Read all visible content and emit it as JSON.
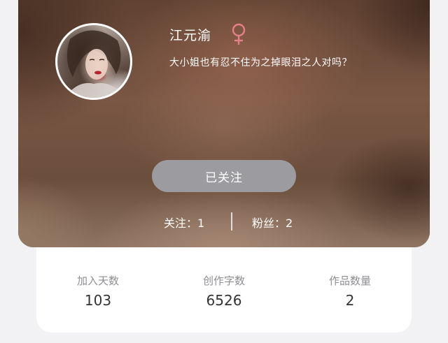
{
  "profile": {
    "name": "江元渝",
    "bio": "大小姐也有忍不住为之掉眼泪之人对吗？",
    "gender_icon": "female-symbol-icon",
    "gender_color": "#e57f8a"
  },
  "follow_button": {
    "label": "已关注"
  },
  "social": {
    "following": "关注：1",
    "fans": "粉丝：2"
  },
  "metrics": [
    {
      "label": "加入天数",
      "value": "103"
    },
    {
      "label": "创作字数",
      "value": "6526"
    },
    {
      "label": "作品数量",
      "value": "2"
    }
  ],
  "colors": {
    "page_background": "#f2f2f4",
    "button_background": "#9c9ba0",
    "metric_label": "#8e8e93",
    "metric_value": "#333333"
  }
}
